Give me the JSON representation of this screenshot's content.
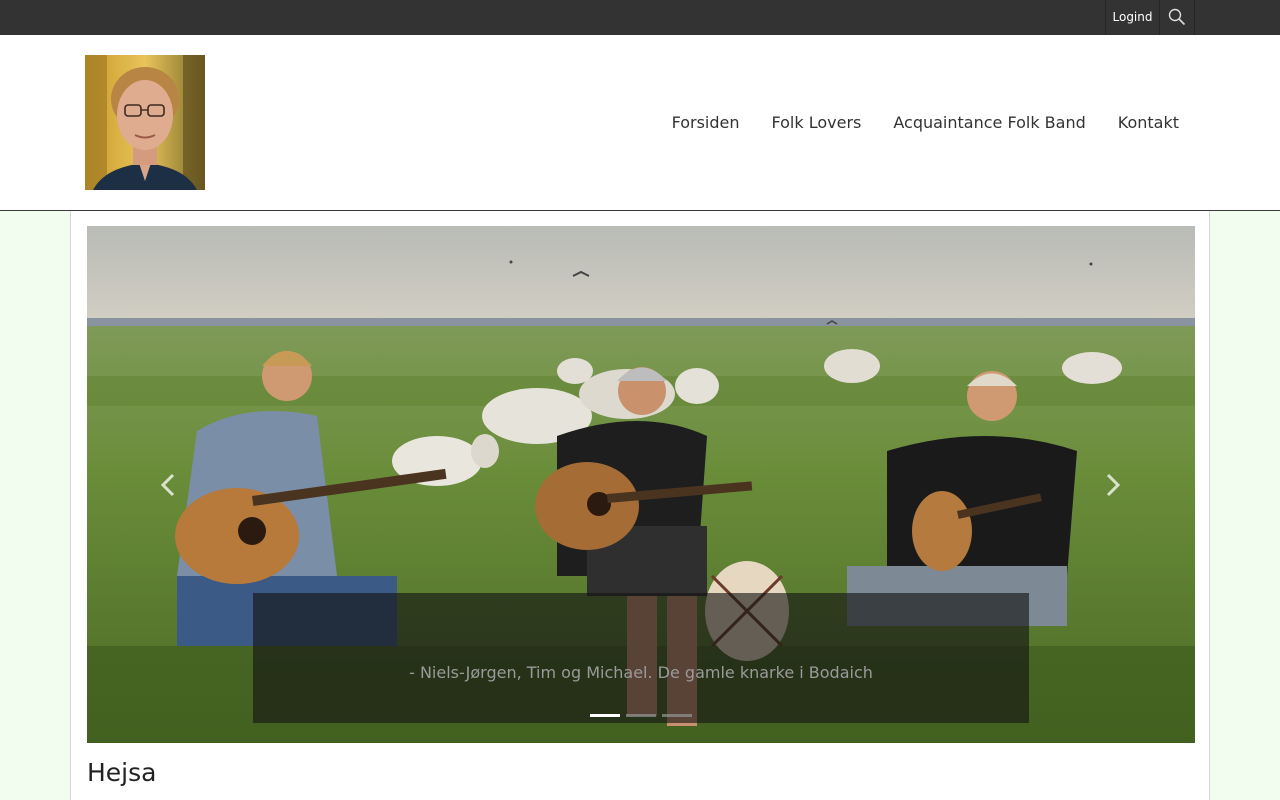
{
  "topbar": {
    "login_label": "Logind",
    "search_icon": "search-icon"
  },
  "header": {
    "logo_alt": "portrait-photo",
    "nav": [
      {
        "label": "Forsiden"
      },
      {
        "label": "Folk Lovers"
      },
      {
        "label": "Acquaintance Folk Band"
      },
      {
        "label": "Kontakt"
      }
    ]
  },
  "slider": {
    "caption": "- Niels-Jørgen, Tim og Michael. De gamle knarke i Bodaich",
    "slide_count": 3,
    "active_slide": 1,
    "prev_icon": "chevron-left-icon",
    "next_icon": "chevron-right-icon"
  },
  "content": {
    "heading": "Hejsa"
  },
  "colors": {
    "topbar": "#333333",
    "page_bg": "#f2fdf0",
    "text": "#333333"
  }
}
